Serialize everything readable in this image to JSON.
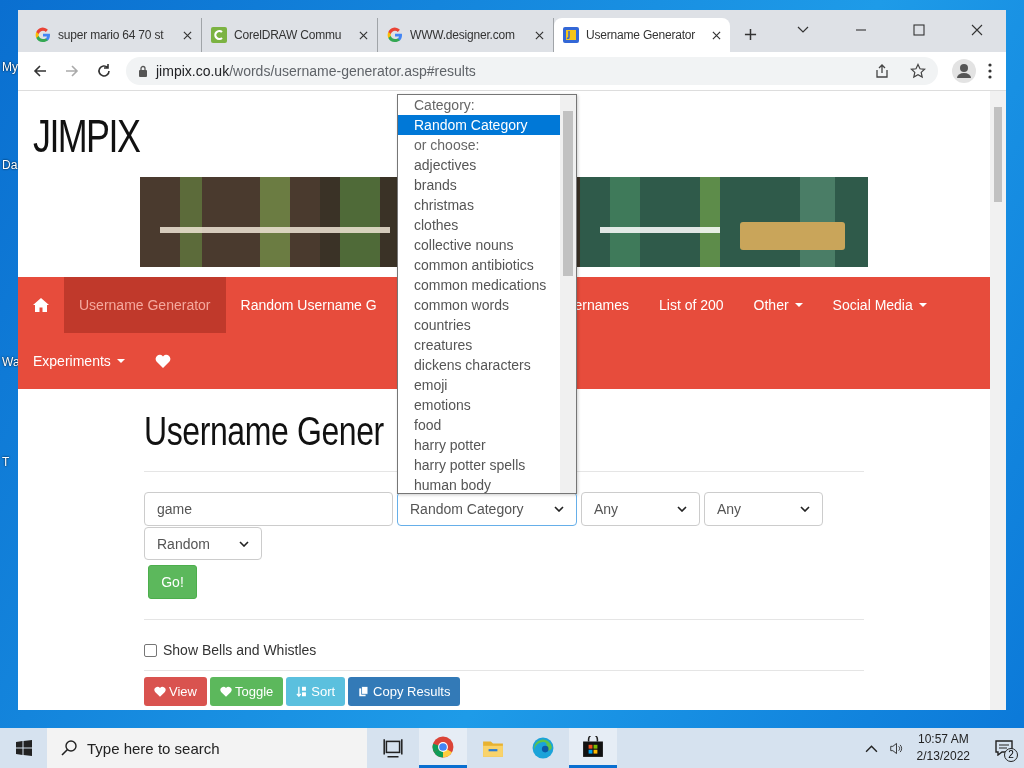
{
  "desktop_icons": [
    {
      "label": "My"
    },
    {
      "label": "Da"
    },
    {
      "label": "Wa"
    },
    {
      "label": "T"
    }
  ],
  "browser": {
    "tabs": [
      {
        "title": "super mario 64 70 st",
        "kind": "google",
        "selected": false
      },
      {
        "title": "CorelDRAW Commu",
        "kind": "corel",
        "selected": false
      },
      {
        "title": "WWW.designer.com",
        "kind": "google",
        "selected": false
      },
      {
        "title": "Username Generator",
        "kind": "site",
        "selected": true
      }
    ],
    "url_domain": "jimpix.co.uk",
    "url_path": "/words/username-generator.asp#results"
  },
  "page": {
    "logo": "JIMPIX",
    "nav": [
      {
        "kind": "home",
        "selected": false
      },
      {
        "kind": "link",
        "label": "Username Generator",
        "selected": true
      },
      {
        "kind": "cut_right",
        "label": "Random Username G",
        "selected": false
      },
      {
        "kind": "cut_left",
        "label": "ernames",
        "selected": false
      },
      {
        "kind": "link",
        "label": "List of 200",
        "selected": false
      },
      {
        "kind": "menu",
        "label": "Other",
        "selected": false
      },
      {
        "kind": "menu",
        "label": "Social Media",
        "selected": false
      },
      {
        "kind": "menu",
        "label": "Experiments",
        "selected": false
      },
      {
        "kind": "heart",
        "selected": false
      }
    ],
    "heading": "Username Gener",
    "form": {
      "word": "game",
      "category": "Random Category",
      "select_3": "Any",
      "select_4": "Any",
      "select_5": "Random",
      "go": "Go!"
    },
    "category_list": [
      {
        "label": "Category:",
        "kind": "caption",
        "selected": false
      },
      {
        "label": "Random Category",
        "kind": "option",
        "selected": true
      },
      {
        "label": "or choose:",
        "kind": "caption",
        "selected": false
      },
      {
        "label": "adjectives",
        "kind": "option",
        "selected": false
      },
      {
        "label": "brands",
        "kind": "option",
        "selected": false
      },
      {
        "label": "christmas",
        "kind": "option",
        "selected": false
      },
      {
        "label": "clothes",
        "kind": "option",
        "selected": false
      },
      {
        "label": "collective nouns",
        "kind": "option",
        "selected": false
      },
      {
        "label": "common antibiotics",
        "kind": "option",
        "selected": false
      },
      {
        "label": "common medications",
        "kind": "option",
        "selected": false
      },
      {
        "label": "common words",
        "kind": "option",
        "selected": false
      },
      {
        "label": "countries",
        "kind": "option",
        "selected": false
      },
      {
        "label": "creatures",
        "kind": "option",
        "selected": false
      },
      {
        "label": "dickens characters",
        "kind": "option",
        "selected": false
      },
      {
        "label": "emoji",
        "kind": "option",
        "selected": false
      },
      {
        "label": "emotions",
        "kind": "option",
        "selected": false
      },
      {
        "label": "food",
        "kind": "option",
        "selected": false
      },
      {
        "label": "harry potter",
        "kind": "option",
        "selected": false
      },
      {
        "label": "harry potter spells",
        "kind": "option",
        "selected": false
      },
      {
        "label": "human body",
        "kind": "option",
        "selected": false
      }
    ],
    "bells": {
      "label": "Show Bells and Whistles",
      "checked": false
    },
    "buttons": [
      {
        "label": "View",
        "kind": "danger"
      },
      {
        "label": "Toggle",
        "kind": "success"
      },
      {
        "label": "Sort",
        "kind": "info"
      },
      {
        "label": "Copy Results",
        "kind": "primary"
      }
    ]
  },
  "taskbar": {
    "search_placeholder": "Type here to search",
    "apps": [
      {
        "kind": "taskview",
        "running": false
      },
      {
        "kind": "chrome",
        "running": true
      },
      {
        "kind": "explorer",
        "running": false
      },
      {
        "kind": "edge",
        "running": false
      },
      {
        "kind": "store",
        "running": true
      }
    ],
    "time": "10:57 AM",
    "date": "2/13/2022",
    "notifications": "2"
  }
}
